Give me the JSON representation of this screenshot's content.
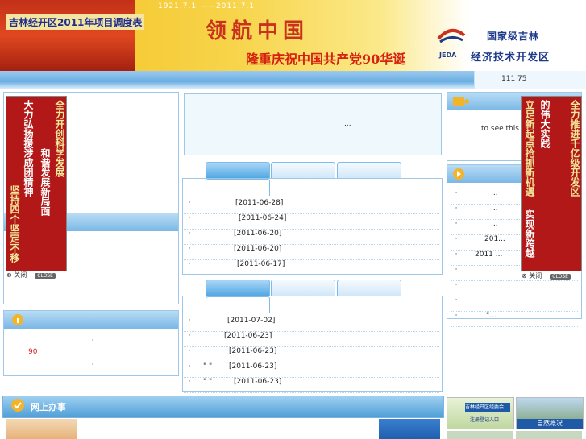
{
  "banner": {
    "left_title": "吉林经开区2011年项目调度表",
    "years": "1921.7.1 ——2011.7.1",
    "lead_title": "领航中国",
    "celebrate": "隆重庆祝中国共产党90华诞",
    "gov_level": "国家级吉林",
    "devzone": "经济技术开发区",
    "jeda": "JEDA"
  },
  "counter": "111 75",
  "left_float": {
    "col1": "大力弘扬援涉成团精神",
    "col2": "坚持四个坚定不移",
    "col3": "全力开创科学发展",
    "col4": "和谐发展新局面",
    "close_label": "关闭",
    "close_btn": "CLOSE"
  },
  "right_float": {
    "col1": "立足新起点抢抓新机遇",
    "col2": "实现新跨越",
    "col3": "全力推进千亿级开发区",
    "col4": "的伟大实践",
    "close_label": "关闭",
    "close_btn": "CLOSE"
  },
  "center_top_text": "...",
  "news1": {
    "rows": [
      {
        "bullet": "·",
        "date": "[2011-06-28]"
      },
      {
        "bullet": "·",
        "date": "[2011-06-24]"
      },
      {
        "bullet": "·",
        "date": "[2011-06-20]"
      },
      {
        "bullet": "·",
        "date": "[2011-06-20]"
      },
      {
        "bullet": "·",
        "date": "[2011-06-17]"
      }
    ]
  },
  "news2": {
    "rows": [
      {
        "bullet": "·",
        "prefix": "",
        "date": "[2011-07-02]"
      },
      {
        "bullet": "·",
        "prefix": "",
        "date": "[2011-06-23]"
      },
      {
        "bullet": "·",
        "prefix": "",
        "date": "[2011-06-23]"
      },
      {
        "bullet": "·",
        "prefix": "\"  \"",
        "date": "[2011-06-23]"
      },
      {
        "bullet": "·",
        "prefix": "\"  \"",
        "date": "[2011-06-23]"
      }
    ]
  },
  "left_panel2": {
    "value": "90"
  },
  "right_panel1": {
    "text": "to see this"
  },
  "right_list": [
    {
      "text": "..."
    },
    {
      "text": "..."
    },
    {
      "text": "..."
    },
    {
      "text": "201..."
    },
    {
      "text": "2011        ..."
    },
    {
      "text": "..."
    },
    {
      "text": ""
    },
    {
      "text": ""
    },
    {
      "text": "\"..."
    }
  ],
  "bottom": {
    "title": "网上办事"
  },
  "thumbs": {
    "t1": "吉林经开区组委会",
    "t1b": "注册登记入口",
    "t2": "自然概况"
  },
  "colors": {
    "accent_blue": "#4fa6e3",
    "banner_red": "#c8321e",
    "float_red": "#b21818"
  }
}
